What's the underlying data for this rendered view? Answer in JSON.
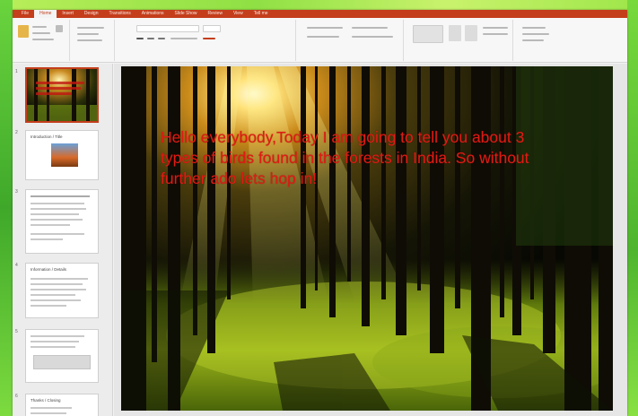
{
  "ribbon": {
    "tabs": [
      "File",
      "Home",
      "Insert",
      "Design",
      "Transitions",
      "Animations",
      "Slide Show",
      "Review",
      "View",
      "Tell me"
    ],
    "active_tab_index": 1
  },
  "slide": {
    "text": "Hello everybody,Today I am going to tell you about 3 types of birds found in the forests in India. So without further ado lets hop in!",
    "text_color": "#e11b14"
  },
  "thumbnails": [
    {
      "number": "1",
      "title": ""
    },
    {
      "number": "2",
      "title": "Introduction / Title"
    },
    {
      "number": "3",
      "title": ""
    },
    {
      "number": "4",
      "title": "Information / Details"
    },
    {
      "number": "5",
      "title": ""
    },
    {
      "number": "6",
      "title": "Thanks / Closing"
    }
  ],
  "colors": {
    "accent": "#c43e1c",
    "desktop": "#5cc83a"
  }
}
